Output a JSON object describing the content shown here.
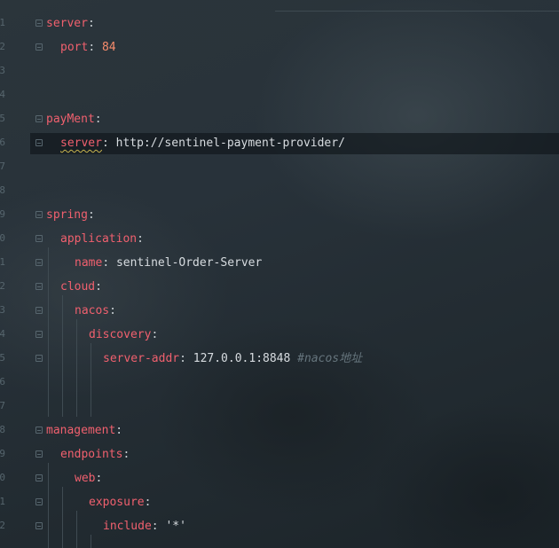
{
  "line_numbers": [
    "1",
    "2",
    "3",
    "4",
    "5",
    "6",
    "7",
    "8",
    "9",
    "0",
    "1",
    "2",
    "3",
    "4",
    "5",
    "6",
    "7",
    "8",
    "9",
    "0",
    "1",
    "2"
  ],
  "code": {
    "l1_key": "server",
    "l2_key": "port",
    "l2_val": "84",
    "l5_key": "payMent",
    "l6_key": "server",
    "l6_val": "http://sentinel-payment-provider/",
    "l9_key": "spring",
    "l10_key": "application",
    "l11_key": "name",
    "l11_val": "sentinel-Order-Server",
    "l12_key": "cloud",
    "l13_key": "nacos",
    "l14_key": "discovery",
    "l15_key": "server-addr",
    "l15_val": "127.0.0.1:8848",
    "l15_comment": "#nacos地址",
    "l18_key": "management",
    "l19_key": "endpoints",
    "l20_key": "web",
    "l21_key": "exposure",
    "l22_key": "include",
    "l22_val": "'*'"
  },
  "colors": {
    "key": "#f0606e",
    "number": "#f78c6c",
    "text": "#d7dce0",
    "comment": "#66757d",
    "background": "#263238"
  }
}
